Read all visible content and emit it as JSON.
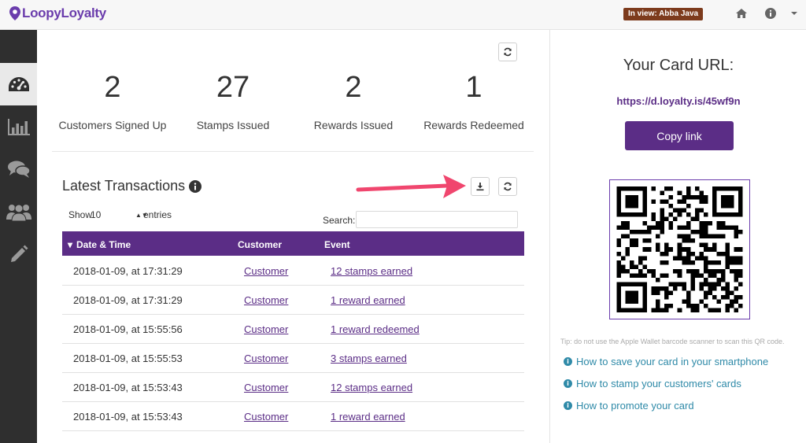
{
  "header": {
    "logo_text": "LoopyLoyalty",
    "view_badge": "In view: Abba Java",
    "icons": [
      "home-icon",
      "info-icon",
      "caret-down-icon"
    ]
  },
  "sidebar": {
    "items": [
      {
        "icon": "dashboard-icon",
        "active": true
      },
      {
        "icon": "bar-chart-icon",
        "active": false
      },
      {
        "icon": "chat-icon",
        "active": false
      },
      {
        "icon": "users-icon",
        "active": false
      },
      {
        "icon": "pencil-icon",
        "active": false
      }
    ]
  },
  "stats": [
    {
      "value": "2",
      "label": "Customers Signed Up"
    },
    {
      "value": "27",
      "label": "Stamps Issued"
    },
    {
      "value": "2",
      "label": "Rewards Issued"
    },
    {
      "value": "1",
      "label": "Rewards Redeemed"
    }
  ],
  "transactions": {
    "title": "Latest Transactions",
    "show_label": "Show",
    "show_value": "10",
    "entries_label": "entries",
    "search_label": "Search:",
    "search_value": "",
    "columns": [
      "Date & Time",
      "Customer",
      "Event"
    ],
    "rows": [
      {
        "date": "2018-01-09, at 17:31:29",
        "customer": "Customer",
        "event": "12 stamps earned"
      },
      {
        "date": "2018-01-09, at 17:31:29",
        "customer": "Customer",
        "event": "1 reward earned"
      },
      {
        "date": "2018-01-09, at 15:55:56",
        "customer": "Customer",
        "event": "1 reward redeemed"
      },
      {
        "date": "2018-01-09, at 15:55:53",
        "customer": "Customer",
        "event": "3 stamps earned"
      },
      {
        "date": "2018-01-09, at 15:53:43",
        "customer": "Customer",
        "event": "12 stamps earned"
      },
      {
        "date": "2018-01-09, at 15:53:43",
        "customer": "Customer",
        "event": "1 reward earned"
      }
    ]
  },
  "card": {
    "title": "Your Card URL:",
    "url": "https://d.loyalty.is/45wf9n",
    "copy_label": "Copy link",
    "tip": "Tip: do not use the Apple Wallet barcode scanner to scan this QR code.",
    "help_links": [
      "How to save your card in your smartphone",
      "How to stamp your customers' cards",
      "How to promote your card"
    ]
  },
  "colors": {
    "brand_purple": "#5b2d86",
    "badge_brown": "#7d3b1d",
    "arrow_pink": "#f0466e",
    "help_blue": "#2f8aa8"
  }
}
